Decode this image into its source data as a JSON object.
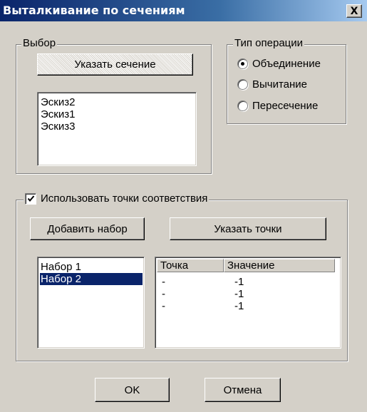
{
  "window": {
    "title": "Выталкивание по сечениям",
    "close_glyph": "X"
  },
  "selection_group": {
    "legend": "Выбор",
    "pick_section_button": "Указать сечение",
    "sections": [
      "Эскиз2",
      "Эскиз1",
      "Эскиз3"
    ]
  },
  "operation_group": {
    "legend": "Тип операции",
    "options": [
      {
        "label": "Объединение",
        "selected": true
      },
      {
        "label": "Вычитание",
        "selected": false
      },
      {
        "label": "Пересечение",
        "selected": false
      }
    ]
  },
  "correspondence": {
    "checkbox_label": "Использовать точки соответствия",
    "checked": true,
    "add_set_button": "Добавить набор",
    "pick_points_button": "Указать точки",
    "sets": [
      {
        "label": "Набор 1",
        "selected": false
      },
      {
        "label": "Набор 2",
        "selected": true
      }
    ],
    "table": {
      "columns": [
        "Точка",
        "Значение"
      ],
      "rows": [
        [
          "-",
          "-1"
        ],
        [
          "-",
          "-1"
        ],
        [
          "-",
          "-1"
        ]
      ]
    }
  },
  "footer": {
    "ok_button": "OK",
    "cancel_button": "Отмена"
  },
  "colors": {
    "face": "#d4d0c8",
    "title_start": "#0a246a",
    "selection": "#0a246a"
  }
}
